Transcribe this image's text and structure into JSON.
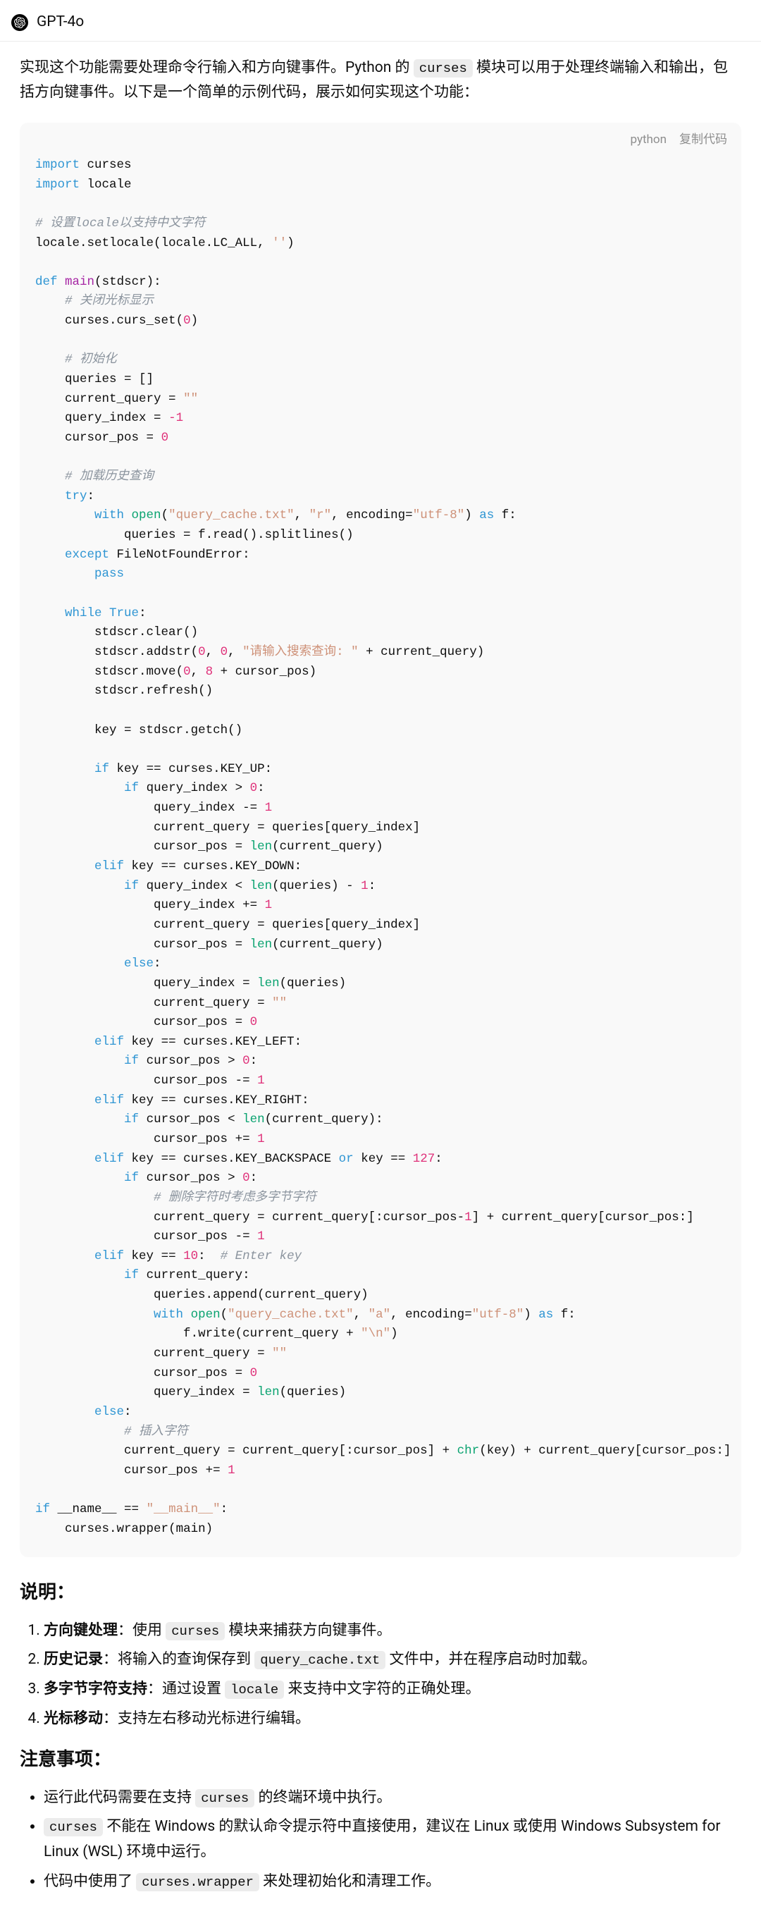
{
  "header": {
    "model": "GPT-4o"
  },
  "intro_parts": {
    "p1a": "实现这个功能需要处理命令行输入和方向键事件。Python 的 ",
    "p1code": "curses",
    "p1b": " 模块可以用于处理终端输入和输出，包括方向键事件。以下是一个简单的示例代码，展示如何实现这个功能："
  },
  "code": {
    "lang": "python",
    "copy": "复制代码",
    "t": {
      "import": "import",
      "def": "def",
      "if": "if",
      "elif": "elif",
      "else": "else",
      "while": "while",
      "True": "True",
      "try": "try",
      "except": "except",
      "with": "with",
      "as": "as",
      "or": "or",
      "pass": "pass",
      "curses": "curses",
      "locale": "locale",
      "setlocale": "setlocale",
      "LC_ALL": "LC_ALL",
      "emptystr": "''",
      "main": "main",
      "stdscr": "stdscr",
      "curs_set": "curs_set",
      "zero": "0",
      "one": "1",
      "eight": "8",
      "neg1": "-1",
      "ten": "10",
      "n127": "127",
      "queries": "queries",
      "empties": "[]",
      "current_query": "current_query",
      "dq": "\"\"",
      "query_index": "query_index",
      "cursor_pos": "cursor_pos",
      "open": "open",
      "len": "len",
      "chr": "chr",
      "qcache": "\"query_cache.txt\"",
      "r": "\"r\"",
      "a": "\"a\"",
      "enc": "encoding",
      "utf8": "\"utf-8\"",
      "f": "f",
      "read": "read",
      "splitlines": "splitlines",
      "FileNotFoundError": "FileNotFoundError",
      "clear": "clear",
      "addstr": "addstr",
      "prompt": "\"请输入搜索查询: \"",
      "move": "move",
      "refresh": "refresh",
      "key": "key",
      "getch": "getch",
      "KEY_UP": "KEY_UP",
      "KEY_DOWN": "KEY_DOWN",
      "KEY_LEFT": "KEY_LEFT",
      "KEY_RIGHT": "KEY_RIGHT",
      "KEY_BACKSPACE": "KEY_BACKSPACE",
      "append": "append",
      "write": "write",
      "nl": "\"\\n\"",
      "name": "__name__",
      "mainstr": "\"__main__\"",
      "wrapper": "wrapper",
      "c_locale": "# 设置locale以支持中文字符",
      "c_cursor": "# 关闭光标显示",
      "c_init": "# 初始化",
      "c_loadhist": "# 加载历史查询",
      "c_del": "# 删除字符时考虑多字节字符",
      "c_enter": "# Enter key",
      "c_insert": "# 插入字符"
    }
  },
  "explain": {
    "title": "说明：",
    "items": [
      {
        "label": "方向键处理",
        "sep": "：使用 ",
        "code": "curses",
        "after": " 模块来捕获方向键事件。"
      },
      {
        "label": "历史记录",
        "sep": "：将输入的查询保存到 ",
        "code": "query_cache.txt",
        "after": " 文件中，并在程序启动时加载。"
      },
      {
        "label": "多字节字符支持",
        "sep": "：通过设置 ",
        "code": "locale",
        "after": " 来支持中文字符的正确处理。"
      },
      {
        "label": "光标移动",
        "sep": "：支持左右移动光标进行编辑。",
        "code": "",
        "after": ""
      }
    ]
  },
  "notes": {
    "title": "注意事项：",
    "items": [
      {
        "before": "运行此代码需要在支持 ",
        "code": "curses",
        "after": " 的终端环境中执行。"
      },
      {
        "before": "",
        "code": "curses",
        "after": " 不能在 Windows 的默认命令提示符中直接使用，建议在 Linux 或使用 Windows Subsystem for Linux (WSL) 环境中运行。"
      },
      {
        "before": "代码中使用了 ",
        "code": "curses.wrapper",
        "after": " 来处理初始化和清理工作。"
      }
    ]
  }
}
